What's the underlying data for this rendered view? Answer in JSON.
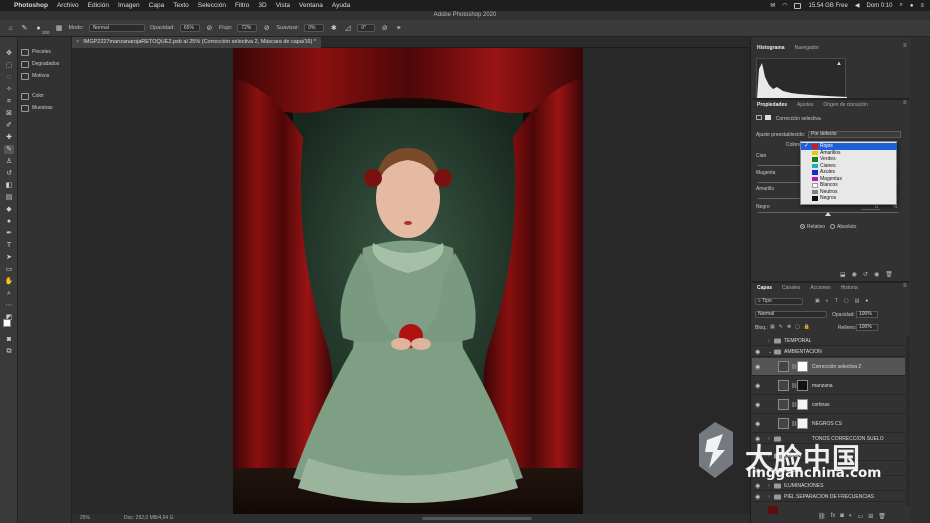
{
  "menubar": {
    "app_name": "Photoshop",
    "items": [
      "Archivo",
      "Edición",
      "Imagen",
      "Capa",
      "Texto",
      "Selección",
      "Filtro",
      "3D",
      "Vista",
      "Ventana",
      "Ayuda"
    ],
    "storage": "15.54 GB Free",
    "clock": "Dom 0:10"
  },
  "window_title": "Adobe Photoshop 2020",
  "options_bar": {
    "brush_size": "300",
    "mode_label": "Modo:",
    "mode_value": "Normal",
    "opacity_label": "Opacidad:",
    "opacity_value": "65%",
    "flow_label": "Flujo:",
    "flow_value": "72%",
    "smooth_label": "Suavizar:",
    "smooth_value": "0%",
    "angle_value": "0°"
  },
  "left_panels": {
    "items": [
      "Pinceles",
      "Degradados",
      "Motivos",
      "Color",
      "Muestras"
    ]
  },
  "document": {
    "tab_title": "IMGP2227manzanarojaRETOQUE2.psb al 25% (Corrección selectiva 2, Máscara de capa/16) *"
  },
  "status_bar": {
    "zoom": "25%",
    "doc_info": "Doc: 292,0 MB/4,64 G"
  },
  "histogram_panel": {
    "tabs": [
      "Histograma",
      "Navegador"
    ]
  },
  "properties_panel": {
    "tabs": [
      "Propiedades",
      "Ajustes",
      "Origen de clonación"
    ],
    "adjustment_title": "Corrección selectiva",
    "preset_label": "Ajuste preestablecido:",
    "preset_value": "Por defecto",
    "colors_label": "Colores:",
    "sliders": [
      {
        "label": "Cian",
        "value": ""
      },
      {
        "label": "Magenta",
        "value": ""
      },
      {
        "label": "Amarillo",
        "value": ""
      },
      {
        "label": "Negro",
        "value": "0",
        "unit": "%"
      }
    ],
    "method_options": [
      "Relativo",
      "Absoluto"
    ],
    "method_selected": "Relativo"
  },
  "color_menu": {
    "items": [
      {
        "label": "Rojos",
        "color": "#d11a1a",
        "selected": true
      },
      {
        "label": "Amarillos",
        "color": "#e8c700",
        "selected": false
      },
      {
        "label": "Verdes",
        "color": "#1f7a1f",
        "selected": false
      },
      {
        "label": "Cianes",
        "color": "#19b0c0",
        "selected": false
      },
      {
        "label": "Azules",
        "color": "#1a2ad0",
        "selected": false
      },
      {
        "label": "Magentas",
        "color": "#b01ab0",
        "selected": false
      },
      {
        "label": "Blancos",
        "color": "#ffffff",
        "selected": false
      },
      {
        "label": "Neutros",
        "color": "#808080",
        "selected": false
      },
      {
        "label": "Negros",
        "color": "#101010",
        "selected": false
      }
    ]
  },
  "layers_panel": {
    "tabs": [
      "Capas",
      "Canales",
      "Acciones",
      "Historia"
    ],
    "filter_label": "Tipo",
    "blend_mode": "Normal",
    "opacity_label": "Opacidad:",
    "opacity_value": "100%",
    "lock_label": "Bloq.:",
    "fill_label": "Relleno:",
    "fill_value": "100%",
    "layers": [
      {
        "name": "TEMPORAL",
        "kind": "group",
        "visible": false,
        "selected": false
      },
      {
        "name": "AMBIENTACION",
        "kind": "group",
        "visible": true,
        "selected": false
      },
      {
        "name": "Corrección selectiva 2",
        "kind": "adjustment",
        "visible": true,
        "selected": true
      },
      {
        "name": "manzana",
        "kind": "adjustment",
        "visible": true,
        "selected": false
      },
      {
        "name": "cortinas",
        "kind": "adjustment",
        "visible": true,
        "selected": false
      },
      {
        "name": "NEGROS CS",
        "kind": "adjustment",
        "visible": true,
        "selected": false
      },
      {
        "name": "TONOS CORRECCION SUELO",
        "kind": "group",
        "visible": true,
        "selected": false
      },
      {
        "name": "COLOR",
        "kind": "group",
        "visible": true,
        "selected": false
      },
      {
        "name": "FONDO",
        "kind": "group",
        "visible": true,
        "selected": false
      },
      {
        "name": "ILUMINACIONES",
        "kind": "group",
        "visible": true,
        "selected": false
      },
      {
        "name": "PIEL SEPARACION DE FRECUENCIAS",
        "kind": "group",
        "visible": true,
        "selected": false
      }
    ]
  },
  "watermark": {
    "chinese": "大脸中国",
    "url": "lingganchina.com"
  }
}
